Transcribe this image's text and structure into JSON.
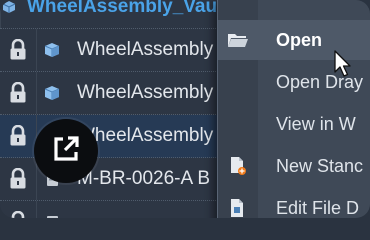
{
  "file_list": {
    "rows": [
      {
        "name": "WheelAssembly_VaultSearch.iam",
        "kind": "header"
      },
      {
        "name": "WheelAssembly",
        "kind": "assembly",
        "locked": true
      },
      {
        "name": "WheelAssembly",
        "kind": "assembly",
        "locked": true
      },
      {
        "name": "WheelAssembly",
        "kind": "assembly",
        "locked": true
      },
      {
        "name": "M-BR-0026-A B",
        "kind": "part",
        "locked": true
      },
      {
        "name": "",
        "kind": "part",
        "locked": true
      }
    ]
  },
  "context_menu": {
    "items": [
      {
        "label": "Open",
        "icon": "folder-open-icon",
        "highlighted": true
      },
      {
        "label": "Open Dray",
        "icon": "",
        "highlighted": false
      },
      {
        "label": "View in W",
        "icon": "",
        "highlighted": false
      },
      {
        "label": "New Stanc",
        "icon": "new-document-icon",
        "highlighted": false
      },
      {
        "label": "Edit File D",
        "icon": "edit-file-icon",
        "highlighted": false
      }
    ]
  },
  "overlay": {
    "icon": "open-external-link-icon"
  },
  "colors": {
    "background": "#2d3644",
    "menu_background": "#3f4957",
    "menu_highlight": "#4e5968",
    "header_text": "#4aa3e8",
    "row_text": "#e3e7ec",
    "badge_background": "#0b0d10"
  }
}
